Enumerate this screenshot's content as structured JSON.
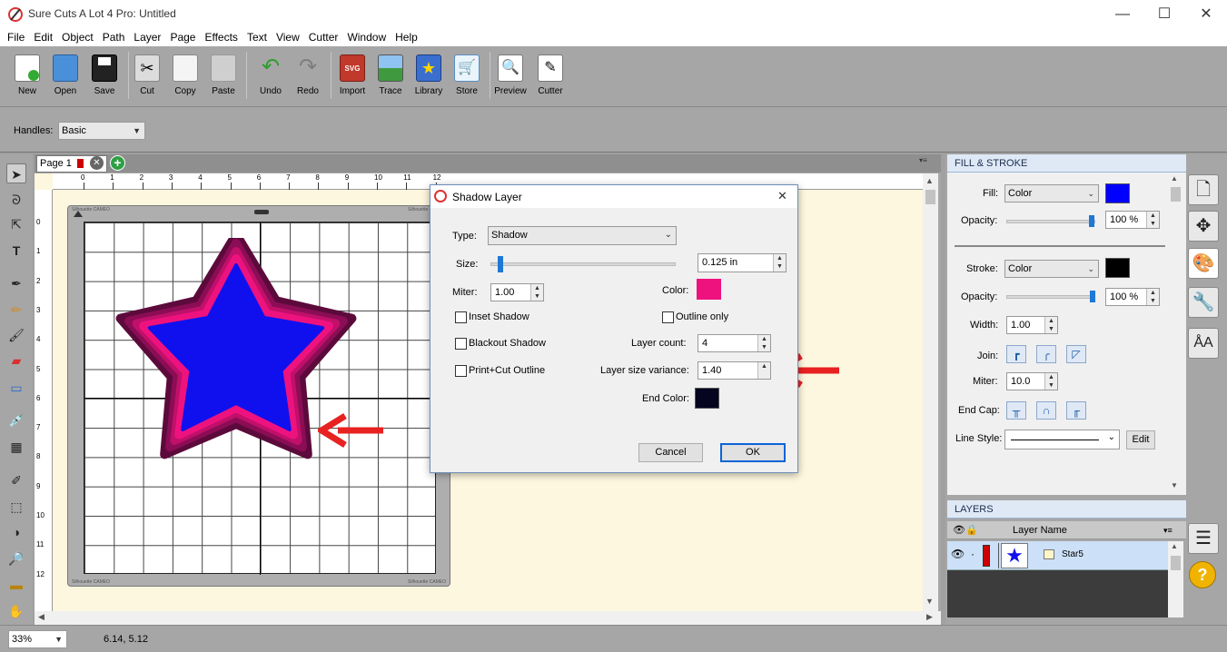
{
  "window": {
    "title": "Sure Cuts A Lot 4 Pro: Untitled",
    "minimize_glyph": "—",
    "maximize_glyph": "☐",
    "close_glyph": "✕"
  },
  "menu": [
    "File",
    "Edit",
    "Object",
    "Path",
    "Layer",
    "Page",
    "Effects",
    "Text",
    "View",
    "Cutter",
    "Window",
    "Help"
  ],
  "toolbar": {
    "new": "New",
    "open": "Open",
    "save": "Save",
    "cut": "Cut",
    "copy": "Copy",
    "paste": "Paste",
    "undo": "Undo",
    "redo": "Redo",
    "import": "Import",
    "trace": "Trace",
    "library": "Library",
    "store": "Store",
    "preview": "Preview",
    "cutter": "Cutter"
  },
  "options": {
    "handles_label": "Handles:",
    "handles_value": "Basic"
  },
  "tabs": {
    "page_label": "Page 1"
  },
  "ruler": {
    "top": [
      "0",
      "1",
      "2",
      "3",
      "4",
      "5",
      "6",
      "7",
      "8",
      "9",
      "10",
      "11",
      "12"
    ],
    "left": [
      "0",
      "1",
      "2",
      "3",
      "4",
      "5",
      "6",
      "7",
      "8",
      "9",
      "10",
      "11",
      "12"
    ]
  },
  "mat": {
    "brand_tl": "Silhouette CAMEO",
    "brand_tr": "Silhouette CAMEO",
    "brand_bl": "Silhouette CAMEO",
    "brand_br": "Silhouette CAMEO"
  },
  "status": {
    "zoom": "33%",
    "coords": "6.14, 5.12"
  },
  "fill_stroke": {
    "header": "FILL & STROKE",
    "fill_label": "Fill:",
    "fill_type": "Color",
    "fill_color": "#0000ff",
    "fill_opacity_label": "Opacity:",
    "fill_opacity": "100 %",
    "stroke_label": "Stroke:",
    "stroke_type": "Color",
    "stroke_color": "#000000",
    "stroke_opacity_label": "Opacity:",
    "stroke_opacity": "100 %",
    "width_label": "Width:",
    "width_value": "1.00",
    "join_label": "Join:",
    "miter_label": "Miter:",
    "miter_value": "10.0",
    "endcap_label": "End Cap:",
    "linestyle_label": "Line Style:",
    "edit_button": "Edit"
  },
  "layers": {
    "header": "LAYERS",
    "col_name": "Layer Name",
    "items": [
      {
        "name": "Star5",
        "color": "#cc0000"
      }
    ]
  },
  "dialog": {
    "title": "Shadow Layer",
    "close_glyph": "✕",
    "type_label": "Type:",
    "type_value": "Shadow",
    "size_label": "Size:",
    "size_value": "0.125 in",
    "size_level": 0.02,
    "miter_label": "Miter:",
    "miter_value": "1.00",
    "color_label": "Color:",
    "color_value": "#ee127f",
    "inset_shadow": "Inset Shadow",
    "outline_only": "Outline only",
    "blackout_shadow": "Blackout Shadow",
    "layer_count_label": "Layer count:",
    "layer_count_value": "4",
    "print_cut_outline": "Print+Cut Outline",
    "layer_size_variance_label": "Layer size variance:",
    "layer_size_variance_value": "1.40",
    "end_color_label": "End Color:",
    "end_color_value": "#050520",
    "cancel": "Cancel",
    "ok": "OK"
  },
  "design": {
    "star_fill": "#1010ee",
    "shadow_colors": [
      "#ee127f",
      "#c0106a",
      "#8b0d55",
      "#5c0a3c"
    ]
  }
}
